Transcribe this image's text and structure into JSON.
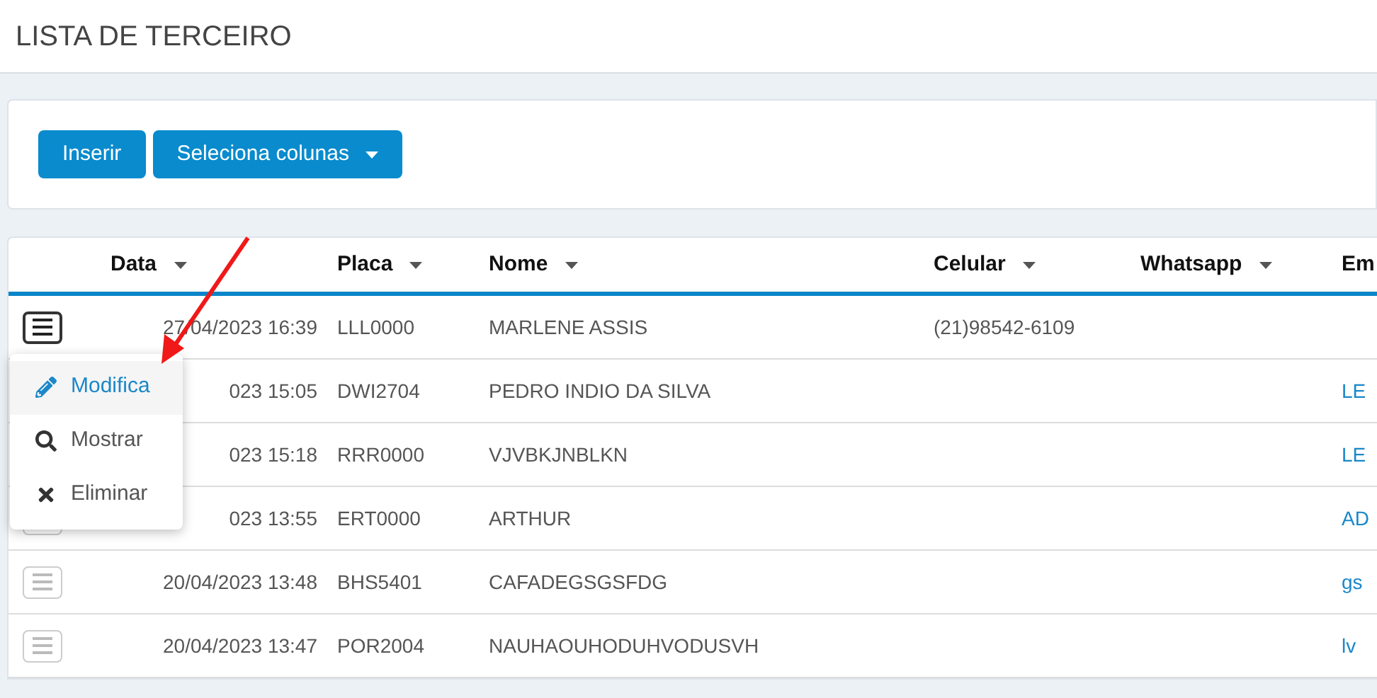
{
  "page_title": "LISTA DE TERCEIRO",
  "toolbar": {
    "buttons": [
      {
        "label": "Inserir",
        "kind": "plain"
      },
      {
        "label": "Seleciona colunas",
        "kind": "dropdown"
      }
    ]
  },
  "table": {
    "columns": [
      "Data",
      "Placa",
      "Nome",
      "Celular",
      "Whatsapp",
      "Em"
    ],
    "rows": [
      {
        "cells": [
          "27/04/2023 16:39",
          "LLL0000",
          "MARLENE ASSIS",
          "(21)98542-6109",
          "",
          ""
        ],
        "menu_open": true
      },
      {
        "cells": [
          "023 15:05",
          "DWI2704",
          "PEDRO INDIO DA SILVA",
          "",
          "",
          "LE"
        ],
        "menu_open": false
      },
      {
        "cells": [
          "023 15:18",
          "RRR0000",
          "VJVBKJNBLKN",
          "",
          "",
          "LE"
        ],
        "menu_open": false
      },
      {
        "cells": [
          "023 13:55",
          "ERT0000",
          "ARTHUR",
          "",
          "",
          "AD"
        ],
        "menu_open": false
      },
      {
        "cells": [
          "20/04/2023 13:48",
          "BHS5401",
          "CAFADEGSGSFDG",
          "",
          "",
          "gs"
        ],
        "menu_open": false
      },
      {
        "cells": [
          "20/04/2023 13:47",
          "POR2004",
          "NAUHAOUHODUHVODUSVH",
          "",
          "",
          "lv"
        ],
        "menu_open": false
      }
    ]
  },
  "row_menu": {
    "items": [
      {
        "label": "Modifica",
        "kind": "edit",
        "selected": true
      },
      {
        "label": "Mostrar",
        "kind": "view",
        "selected": false
      },
      {
        "label": "Eliminar",
        "kind": "delete",
        "selected": false
      }
    ]
  }
}
